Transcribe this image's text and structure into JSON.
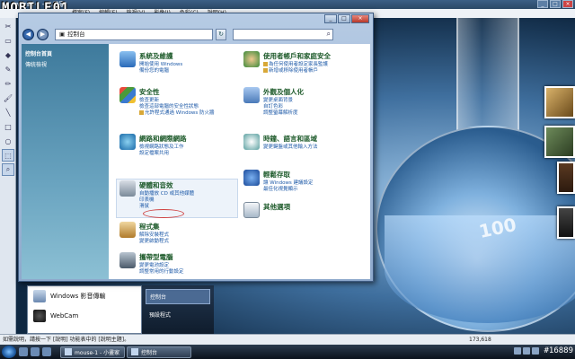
{
  "paint": {
    "logo": "MOBILE01",
    "title": "mouse-1 - 小畫家",
    "menu": [
      "檔案(F)",
      "編輯(E)",
      "檢視(V)",
      "影像(I)",
      "色彩(C)",
      "說明(H)"
    ],
    "status_help": "如需說明，請按一下 [說明] 功能表中的 [說明主題]。",
    "coords": "173,618"
  },
  "window": {
    "breadcrumb": "控制台",
    "search_placeholder": "",
    "sidebar": {
      "home": "控制台首頁",
      "classic": "傳統檢視"
    },
    "categories": [
      {
        "title": "系統及維護",
        "links": [
          "開始使用 Windows",
          "備份您的電腦"
        ],
        "color": "#4c8cd0"
      },
      {
        "title": "使用者帳戶和家庭安全",
        "links": [
          "為任何使用者設定家長監護",
          "新增或移除使用者帳戶"
        ],
        "color": "#3a9a4a"
      },
      {
        "title": "安全性",
        "links": [
          "檢查更新",
          "檢查這部電腦的安全性狀態",
          "允許程式通過 Windows 防火牆"
        ],
        "color": "#d6a020"
      },
      {
        "title": "外觀及個人化",
        "links": [
          "變更桌面背景",
          "自訂色彩",
          "調整螢幕解析度"
        ],
        "color": "#6a8ac8"
      },
      {
        "title": "網路和網際網路",
        "links": [
          "檢視網路狀態及工作",
          "設定檔案共用"
        ],
        "color": "#4a90c0"
      },
      {
        "title": "時鐘、語言和區域",
        "links": [
          "變更鍵盤或其他輸入方法"
        ],
        "color": "#50a0a0"
      },
      {
        "title": "硬體和音效",
        "links": [
          "自動播放 CD 或其他媒體",
          "印表機",
          "滑鼠"
        ],
        "color": "#7a8a9a"
      },
      {
        "title": "輕鬆存取",
        "links": [
          "讓 Windows 建議設定",
          "最佳化視覺顯示"
        ],
        "color": "#2a6ac0"
      },
      {
        "title": "程式集",
        "links": [
          "解除安裝程式",
          "變更啟動程式"
        ],
        "color": "#c08a3a"
      },
      {
        "title": "其他選項",
        "links": [],
        "color": "#5a7aa0"
      },
      {
        "title": "攜帶型電腦",
        "links": [
          "變更電池設定",
          "調整常用的行動設定"
        ],
        "color": "#6a7a8a"
      }
    ]
  },
  "startmenu": {
    "left": [
      {
        "label": "Windows 影音傳輸"
      },
      {
        "label": "WebCam"
      }
    ],
    "right": [
      {
        "label": "控制台"
      },
      {
        "label": "預設程式"
      }
    ]
  },
  "taskbar": {
    "tasks": [
      {
        "label": "mouse-1 - 小畫家"
      },
      {
        "label": "控制台"
      }
    ],
    "watermark": "#16889"
  }
}
